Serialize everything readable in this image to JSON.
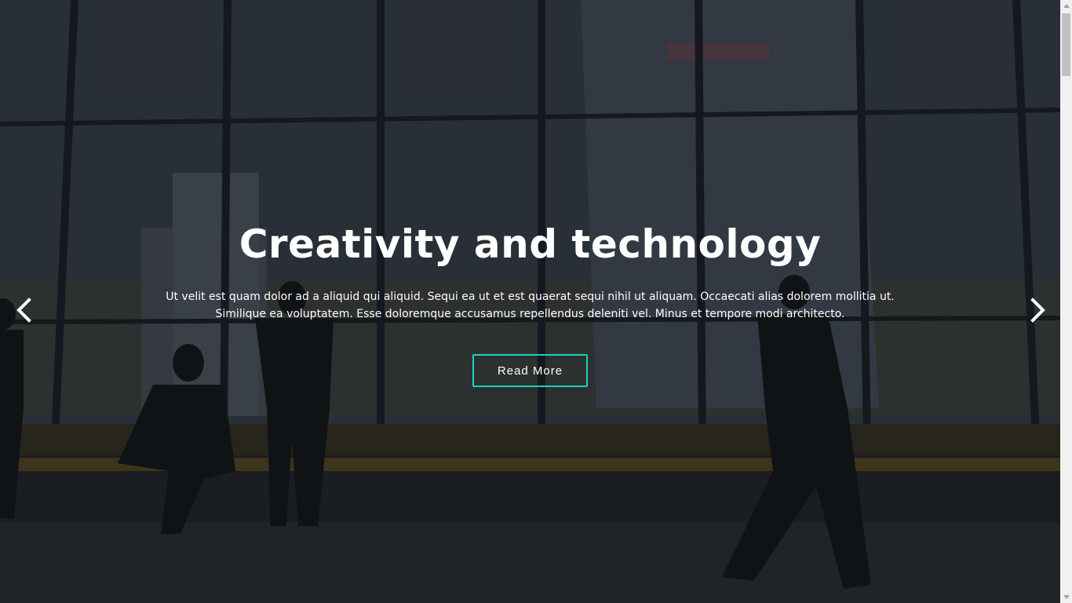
{
  "hero": {
    "title": "Creativity and technology",
    "description": "Ut velit est quam dolor ad a aliquid qui aliquid. Sequi ea ut et est quaerat sequi nihil ut aliquam. Occaecati alias dolorem mollitia ut. Similique ea voluptatem. Esse doloremque accusamus repellendus deleniti vel. Minus et tempore modi architecto.",
    "button_label": "Read More",
    "accent_color": "#18d2c2",
    "background": "office-skyline-photo"
  },
  "carousel": {
    "prev_icon": "chevron-left-icon",
    "next_icon": "chevron-right-icon"
  }
}
